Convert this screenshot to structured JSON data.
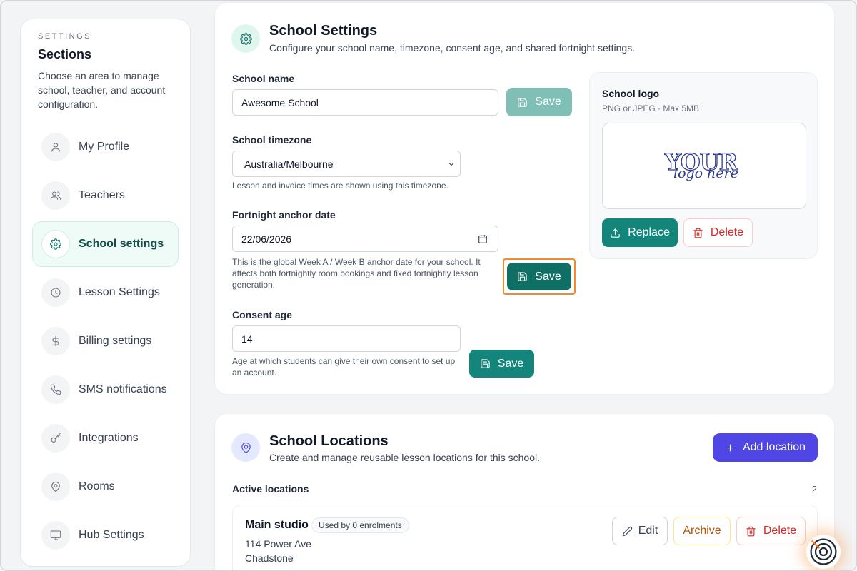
{
  "sidebar": {
    "eyebrow": "SETTINGS",
    "title": "Sections",
    "description": "Choose an area to manage school, teacher, and account configuration.",
    "items": [
      {
        "label": "My Profile",
        "icon": "user-icon"
      },
      {
        "label": "Teachers",
        "icon": "users-icon"
      },
      {
        "label": "School settings",
        "icon": "gear-icon",
        "active": true
      },
      {
        "label": "Lesson Settings",
        "icon": "clock-icon"
      },
      {
        "label": "Billing settings",
        "icon": "dollar-icon"
      },
      {
        "label": "SMS notifications",
        "icon": "phone-icon"
      },
      {
        "label": "Integrations",
        "icon": "key-icon"
      },
      {
        "label": "Rooms",
        "icon": "map-pin-icon"
      },
      {
        "label": "Hub Settings",
        "icon": "monitor-icon"
      }
    ]
  },
  "school_settings": {
    "title": "School Settings",
    "subtitle": "Configure your school name, timezone, consent age, and shared fortnight settings.",
    "name": {
      "label": "School name",
      "value": "Awesome School",
      "save": "Save"
    },
    "timezone": {
      "label": "School timezone",
      "value": "Australia/Melbourne",
      "help": "Lesson and invoice times are shown using this timezone."
    },
    "anchor": {
      "label": "Fortnight anchor date",
      "value": "22/06/2026",
      "help": "This is the global Week A / Week B anchor date for your school. It affects both fortnightly room bookings and fixed fortnightly lesson generation.",
      "save": "Save"
    },
    "consent": {
      "label": "Consent age",
      "value": "14",
      "help": "Age at which students can give their own consent to set up an account.",
      "save": "Save"
    },
    "logo": {
      "title": "School logo",
      "subtitle": "PNG or JPEG · Max 5MB",
      "placeholder_big": "YOUR",
      "placeholder_small": "logo here",
      "replace": "Replace",
      "delete": "Delete"
    }
  },
  "locations": {
    "title": "School Locations",
    "subtitle": "Create and manage reusable lesson locations for this school.",
    "add_label": "Add location",
    "active_label": "Active locations",
    "count": "2",
    "items": [
      {
        "name": "Main studio",
        "badge": "Used by 0 enrolments",
        "address": "114 Power Ave",
        "suburb": "Chadstone",
        "edit": "Edit",
        "archive": "Archive",
        "delete": "Delete"
      }
    ]
  },
  "colors": {
    "accent": "#13857a",
    "primary": "#4f46e5",
    "danger": "#dc2626",
    "highlight": "#f28c28"
  }
}
